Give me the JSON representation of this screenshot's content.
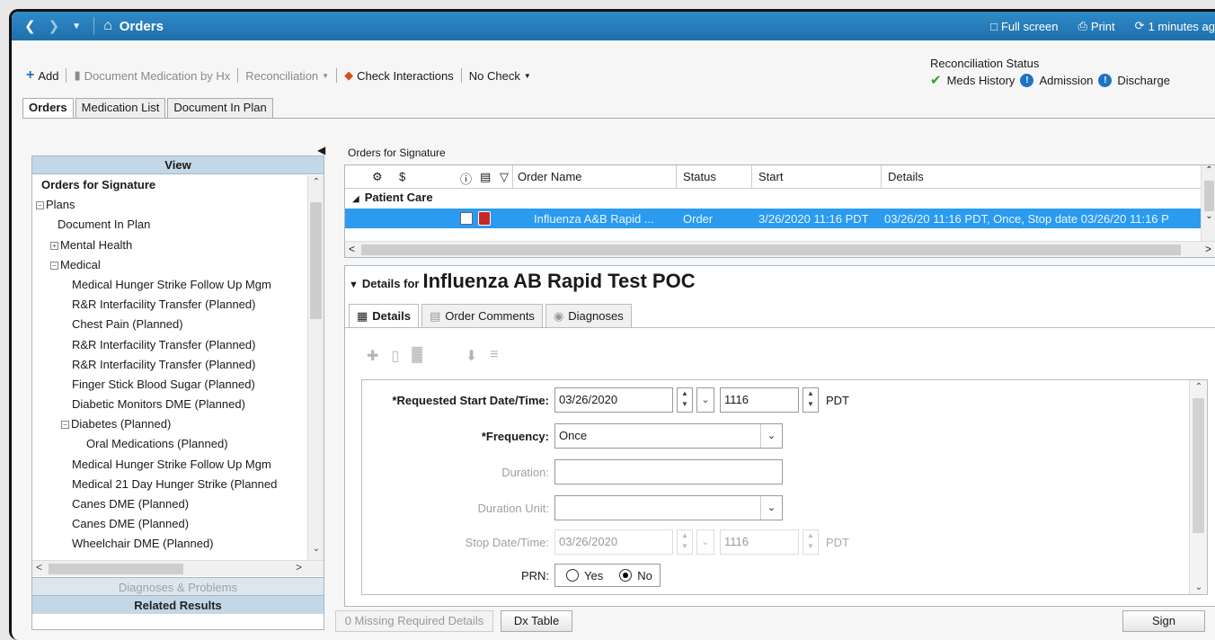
{
  "titlebar": {
    "title": "Orders",
    "fullscreen": "Full screen",
    "print": "Print",
    "refresh": "1 minutes ag"
  },
  "toolbar": {
    "add": "Add",
    "document_medication": "Document Medication by Hx",
    "reconciliation": "Reconciliation",
    "check_interactions": "Check Interactions",
    "no_check": "No Check"
  },
  "reconciliation_status": {
    "label": "Reconciliation Status",
    "meds_history": "Meds History",
    "admission": "Admission",
    "discharge": "Discharge"
  },
  "tabs": [
    "Orders",
    "Medication List",
    "Document In Plan"
  ],
  "view_panel": {
    "header": "View",
    "items": [
      {
        "label": "Orders for Signature",
        "bold": true
      },
      {
        "label": "Plans",
        "exp": "-"
      },
      {
        "label": "Document In Plan"
      },
      {
        "label": "Mental Health",
        "exp": "+"
      },
      {
        "label": "Medical",
        "exp": "-"
      },
      {
        "label": "Medical Hunger Strike Follow Up Mgm"
      },
      {
        "label": "R&R Interfacility Transfer (Planned)"
      },
      {
        "label": "Chest Pain (Planned)"
      },
      {
        "label": "R&R Interfacility Transfer (Planned)"
      },
      {
        "label": "R&R Interfacility Transfer (Planned)"
      },
      {
        "label": "Finger Stick Blood Sugar (Planned)"
      },
      {
        "label": "Diabetic Monitors DME (Planned)"
      },
      {
        "label": "Diabetes (Planned)",
        "exp": "-"
      },
      {
        "label": "Oral Medications (Planned)"
      },
      {
        "label": "Medical Hunger Strike Follow Up Mgm"
      },
      {
        "label": "Medical 21 Day Hunger Strike (Planned"
      },
      {
        "label": "Canes DME (Planned)"
      },
      {
        "label": "Canes DME (Planned)"
      },
      {
        "label": "Wheelchair DME (Planned)"
      }
    ],
    "diagnoses_problems": "Diagnoses & Problems",
    "related_results": "Related Results"
  },
  "orders_for_signature": {
    "label": "Orders for Signature",
    "columns": {
      "dollar": "$",
      "order_name": "Order Name",
      "status": "Status",
      "start": "Start",
      "details": "Details"
    },
    "group": "Patient Care",
    "row": {
      "order_name": "Influenza A&B Rapid ...",
      "status": "Order",
      "start": "3/26/2020 11:16 PDT",
      "details": "03/26/20 11:16 PDT, Once, Stop date 03/26/20 11:16 P"
    }
  },
  "details": {
    "prefix": "Details for",
    "title": "Influenza AB Rapid Test POC",
    "tabs": [
      "Details",
      "Order Comments",
      "Diagnoses"
    ],
    "form": {
      "start_label": "*Requested Start Date/Time:",
      "start_date": "03/26/2020",
      "start_time": "1116",
      "tz": "PDT",
      "frequency_label": "*Frequency:",
      "frequency": "Once",
      "duration_label": "Duration:",
      "duration": "",
      "duration_unit_label": "Duration Unit:",
      "duration_unit": "",
      "stop_label": "Stop Date/Time:",
      "stop_date": "03/26/2020",
      "stop_time": "1116",
      "stop_tz": "PDT",
      "prn_label": "PRN:",
      "prn_yes": "Yes",
      "prn_no": "No"
    }
  },
  "bottom": {
    "missing": "0 Missing Required Details",
    "dx_table": "Dx Table",
    "sign": "Sign"
  },
  "colors": {
    "titlebar": "#1f6fab",
    "selected_row": "#2b9bf0",
    "panel_header": "#c4d7e6"
  }
}
